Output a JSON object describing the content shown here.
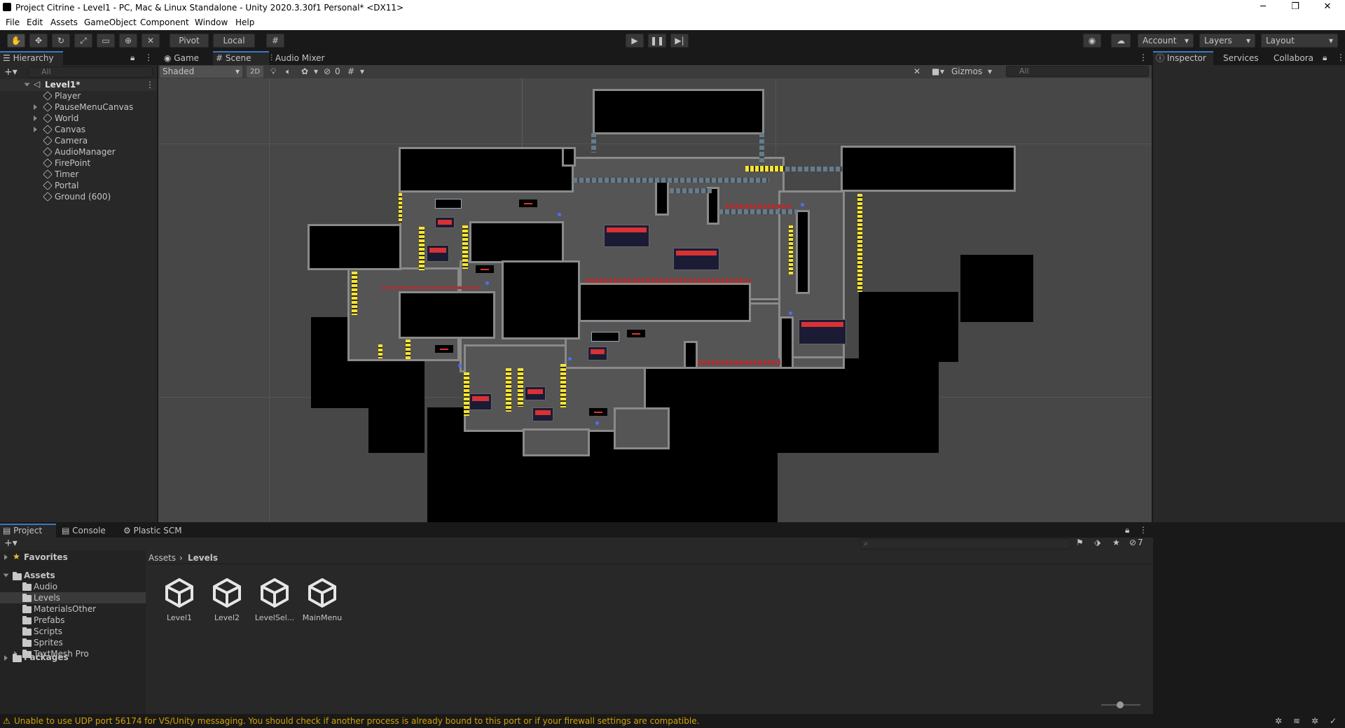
{
  "window": {
    "title": "Project Citrine - Level1 - PC, Mac & Linux Standalone - Unity 2020.3.30f1 Personal* <DX11>",
    "minimize": "─",
    "maximize": "❐",
    "close": "✕"
  },
  "menu": [
    "File",
    "Edit",
    "Assets",
    "GameObject",
    "Component",
    "Window",
    "Help"
  ],
  "toolbar": {
    "pivot_label": "Pivot",
    "local_label": "Local",
    "account_label": "Account",
    "layers_label": "Layers",
    "layout_label": "Layout"
  },
  "hierarchy": {
    "tab_label": "Hierarchy",
    "search_placeholder": "All",
    "scene_name": "Level1*",
    "items": [
      {
        "name": "Player",
        "expandable": false
      },
      {
        "name": "PauseMenuCanvas",
        "expandable": true
      },
      {
        "name": "World",
        "expandable": true
      },
      {
        "name": "Canvas",
        "expandable": true
      },
      {
        "name": "Camera",
        "expandable": false
      },
      {
        "name": "AudioManager",
        "expandable": false
      },
      {
        "name": "FirePoint",
        "expandable": false
      },
      {
        "name": "Timer",
        "expandable": false
      },
      {
        "name": "Portal",
        "expandable": false
      },
      {
        "name": "Ground (600)",
        "expandable": false
      }
    ]
  },
  "center_tabs": [
    "Game",
    "Scene",
    "Audio Mixer"
  ],
  "scene_toolbar": {
    "shading_mode": "Shaded",
    "mode_2d": "2D",
    "hidden_count": "0",
    "gizmos_label": "Gizmos",
    "search_placeholder": "All"
  },
  "right_tabs": [
    "Inspector",
    "Services",
    "Collabora"
  ],
  "bottom_tabs": [
    "Project",
    "Console",
    "Plastic SCM"
  ],
  "project": {
    "favorites_label": "Favorites",
    "assets_label": "Assets",
    "packages_label": "Packages",
    "folders": [
      "Audio",
      "Levels",
      "MaterialsOther",
      "Prefabs",
      "Scripts",
      "Sprites",
      "TextMesh Pro"
    ],
    "selected_folder": "Levels",
    "breadcrumb": [
      "Assets",
      "Levels"
    ],
    "files": [
      "Level1",
      "Level2",
      "LevelSel...",
      "MainMenu"
    ],
    "hidden_count": "7"
  },
  "status": {
    "message": "Unable to use UDP port 56174 for VS/Unity messaging. You should check if another process is already bound to this port or if your firewall settings are compatible."
  },
  "colors": {
    "accent": "#3a79bb",
    "warning": "#d6a200",
    "hazard_yellow": "#f5e33a",
    "spike_red": "#c0282a"
  }
}
